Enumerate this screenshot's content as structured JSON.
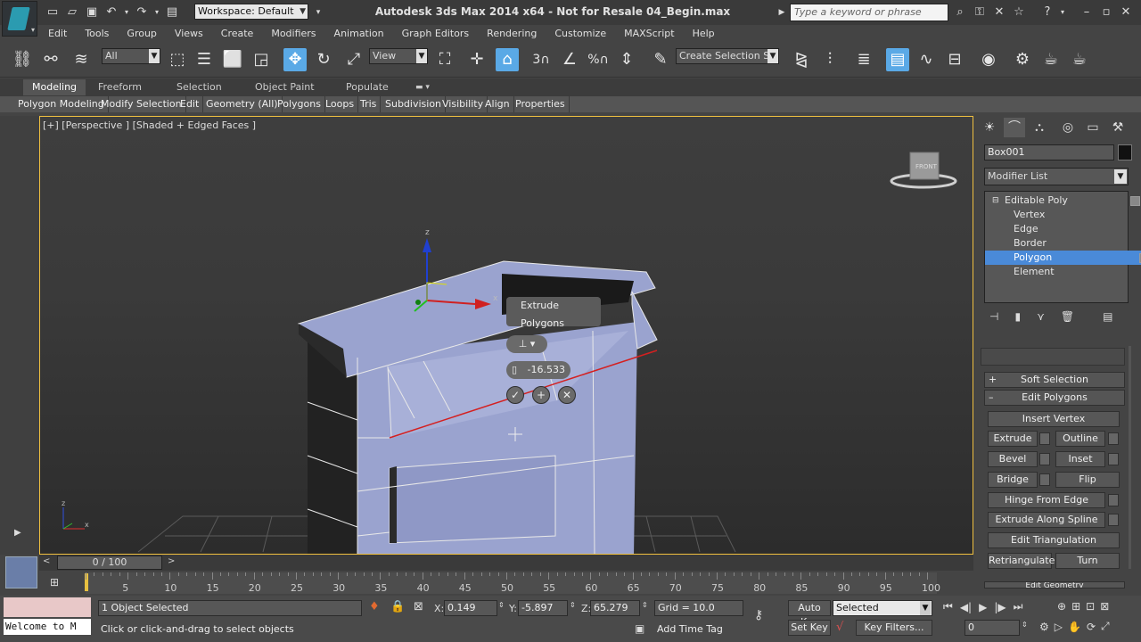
{
  "titlebar": {
    "workspace": "Workspace: Default",
    "app_title": "Autodesk 3ds Max  2014 x64   - Not for Resale   04_Begin.max",
    "search_placeholder": "Type a keyword or phrase"
  },
  "menu": [
    "Edit",
    "Tools",
    "Group",
    "Views",
    "Create",
    "Modifiers",
    "Animation",
    "Graph Editors",
    "Rendering",
    "Customize",
    "MAXScript",
    "Help"
  ],
  "toolbar": {
    "filter": "All",
    "ref_coord": "View",
    "selection_set": "Create Selection Se"
  },
  "ribbon": {
    "tabs": [
      "Modeling",
      "Freeform",
      "Selection",
      "Object Paint",
      "Populate"
    ],
    "panels": [
      "Polygon Modeling",
      "Modify Selection",
      "Edit",
      "Geometry (All)",
      "Polygons",
      "Loops",
      "Tris",
      "Subdivision",
      "Visibility",
      "Align",
      "Properties"
    ]
  },
  "viewport": {
    "label": "[+] [Perspective ] [Shaded + Edged Faces ]",
    "viewcube_face": "FRONT",
    "gizmo_z": "z",
    "gizmo_x": "x",
    "axis_z": "z",
    "axis_x": "x"
  },
  "caddy": {
    "title": "Extrude Polygons",
    "height_value": "-16.533"
  },
  "command_panel": {
    "object_name": "Box001",
    "modifier_list": "Modifier List",
    "stack": [
      {
        "label": "Editable Poly",
        "level": 0,
        "selected": false
      },
      {
        "label": "Vertex",
        "level": 1,
        "selected": false
      },
      {
        "label": "Edge",
        "level": 1,
        "selected": false
      },
      {
        "label": "Border",
        "level": 1,
        "selected": false
      },
      {
        "label": "Polygon",
        "level": 1,
        "selected": true
      },
      {
        "label": "Element",
        "level": 1,
        "selected": false
      }
    ],
    "rollouts": {
      "soft_selection": "Soft Selection",
      "edit_polygons": "Edit Polygons",
      "edit_geometry": "Edit Geometry"
    },
    "buttons": {
      "insert_vertex": "Insert Vertex",
      "extrude": "Extrude",
      "outline": "Outline",
      "bevel": "Bevel",
      "inset": "Inset",
      "bridge": "Bridge",
      "flip": "Flip",
      "hinge_from_edge": "Hinge From Edge",
      "extrude_along_spline": "Extrude Along Spline",
      "edit_triangulation": "Edit Triangulation",
      "retriangulate": "Retriangulate",
      "turn": "Turn"
    }
  },
  "timeline": {
    "frame": "0 / 100",
    "ticks": [
      "5",
      "10",
      "15",
      "20",
      "25",
      "30",
      "35",
      "40",
      "45",
      "50",
      "55",
      "60",
      "65",
      "70",
      "75",
      "80",
      "85",
      "90",
      "95",
      "100"
    ]
  },
  "status": {
    "maxscript_output": "Welcome to M",
    "selection": "1 Object Selected",
    "prompt": "Click or click-and-drag to select objects",
    "x_label": "X:",
    "x": "0.149",
    "y_label": "Y:",
    "y": "-5.897",
    "z_label": "Z:",
    "z": "65.279",
    "grid": "Grid = 10.0",
    "add_time_tag": "Add Time Tag",
    "auto_key": "Auto Key",
    "set_key": "Set Key",
    "key_mode": "Selected",
    "key_filters": "Key Filters...",
    "current_frame": "0"
  }
}
